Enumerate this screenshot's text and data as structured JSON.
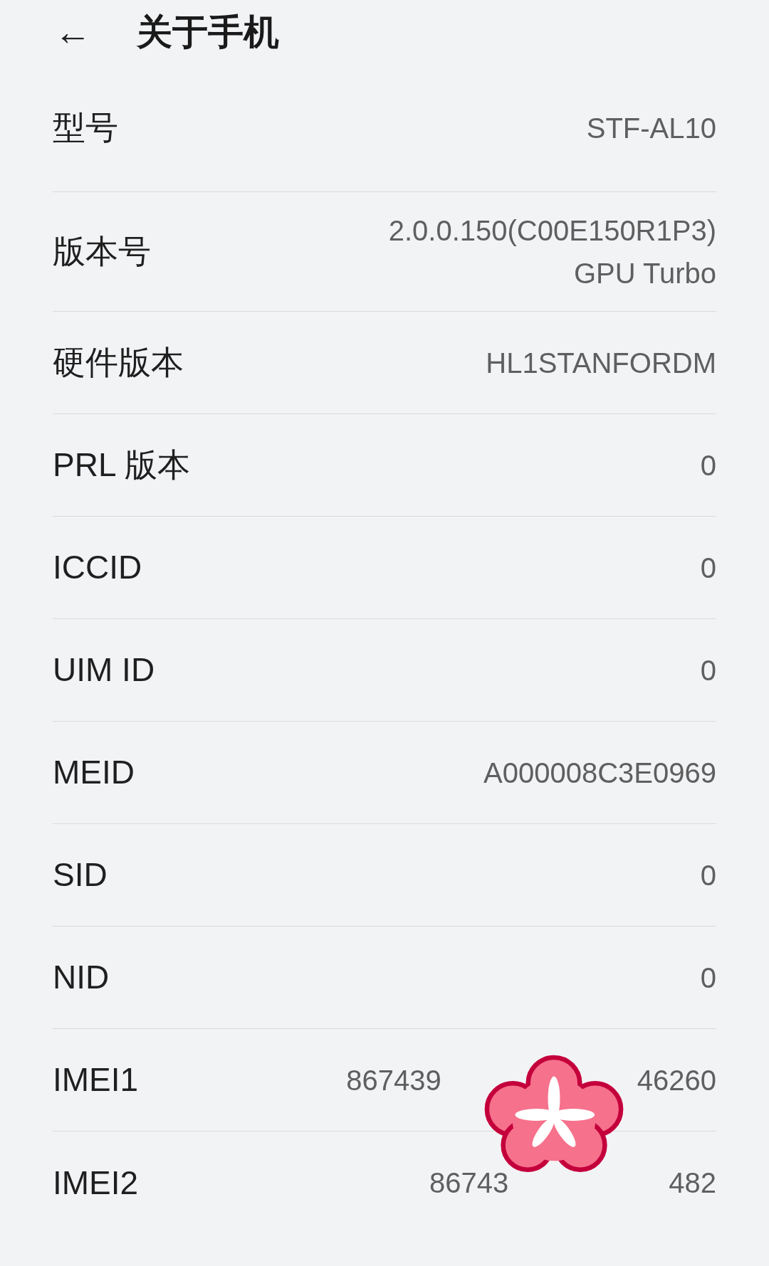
{
  "header": {
    "back_icon": "←",
    "title": "关于手机"
  },
  "rows": [
    {
      "label": "型号",
      "values": [
        "STF-AL10"
      ]
    },
    {
      "label": "版本号",
      "values": [
        "2.0.0.150(C00E150R1P3)",
        "GPU Turbo"
      ]
    },
    {
      "label": "硬件版本",
      "values": [
        "HL1STANFORDM"
      ]
    },
    {
      "label": "PRL 版本",
      "values": [
        "0"
      ]
    },
    {
      "label": "ICCID",
      "values": [
        "0"
      ]
    },
    {
      "label": "UIM ID",
      "values": [
        "0"
      ]
    },
    {
      "label": "MEID",
      "values": [
        "A000008C3E0969"
      ]
    },
    {
      "label": "SID",
      "values": [
        "0"
      ]
    },
    {
      "label": "NID",
      "values": [
        "0"
      ]
    },
    {
      "label": "IMEI1",
      "values": [
        "867439",
        "46260"
      ],
      "kind": "covered"
    },
    {
      "label": "IMEI2",
      "values": [
        "86743",
        "482"
      ],
      "kind": "covered"
    }
  ]
}
